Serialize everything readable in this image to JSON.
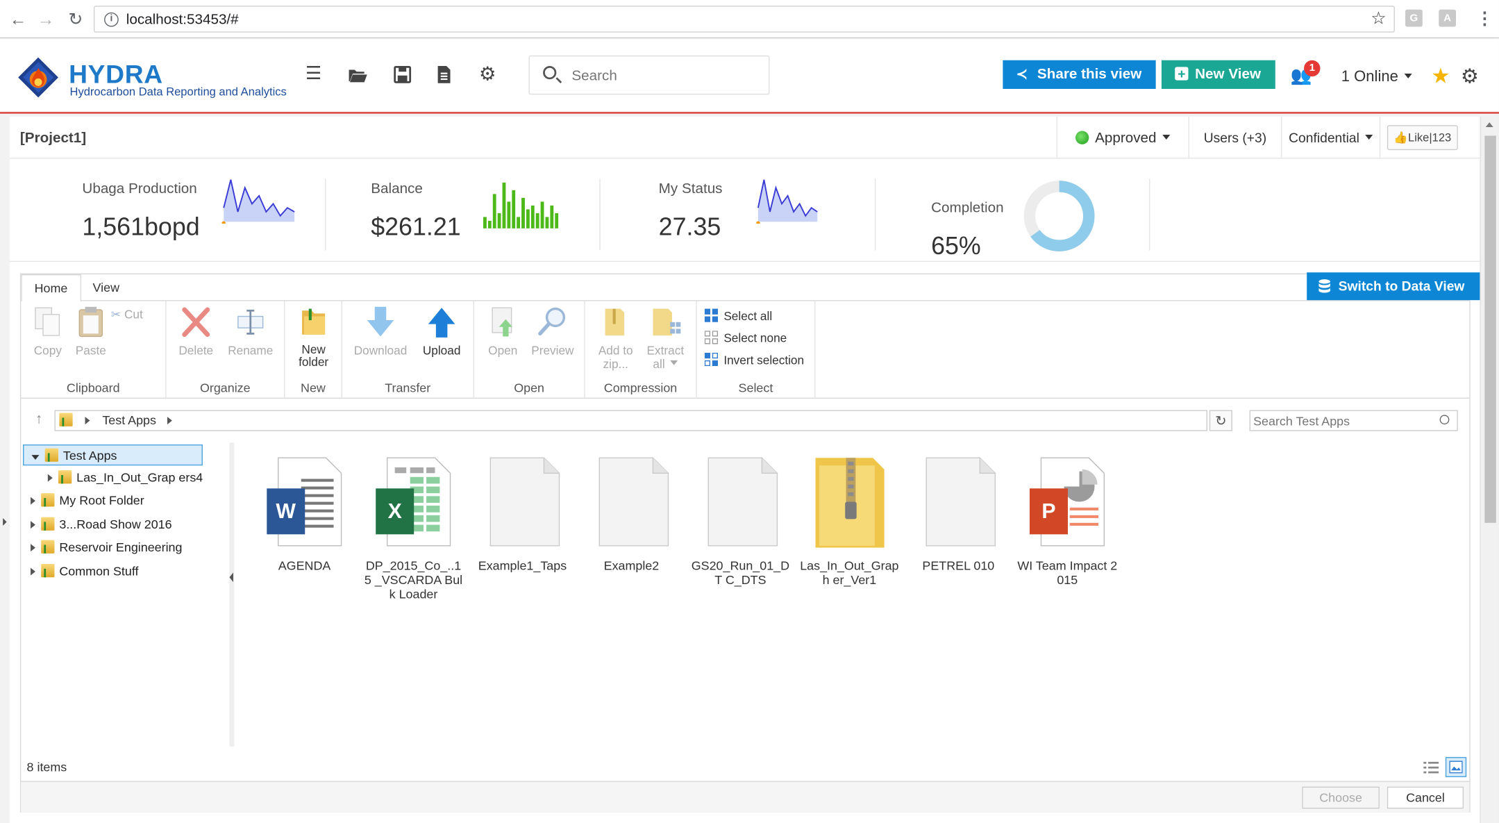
{
  "browser": {
    "url": "localhost:53453/#"
  },
  "header": {
    "brand": "HYDRA",
    "subtitle": "Hydrocarbon Data Reporting and Analytics",
    "search_placeholder": "Search",
    "share_label": "Share this view",
    "new_view_label": "New View",
    "notification_count": "1",
    "online_label": "1 Online",
    "colors": {
      "share": "#0d86d6",
      "new_view": "#1aa793",
      "accent": "#d9534f"
    }
  },
  "project": {
    "title": "[Project1]",
    "status": "Approved",
    "users": "Users (+3)",
    "confidentiality": "Confidential",
    "like": "Like|123"
  },
  "kpis": [
    {
      "label": "Ubaga Production",
      "value": "1,561bopd",
      "spark": [
        3,
        10,
        2,
        8,
        4,
        6,
        2,
        4,
        1,
        3,
        2
      ]
    },
    {
      "label": "Balance",
      "value": "$261.21",
      "bars": [
        3,
        2,
        9,
        4,
        12,
        7,
        10,
        3,
        8,
        5,
        6,
        4,
        7,
        3,
        6,
        4
      ]
    },
    {
      "label": "My Status",
      "value": "27.35",
      "spark": [
        3,
        10,
        2,
        8,
        4,
        6,
        2,
        4,
        1,
        3,
        2
      ]
    },
    {
      "label": "Completion",
      "value": "65%",
      "progress": 0.65
    }
  ],
  "filemanager": {
    "tabs": [
      "Home",
      "View"
    ],
    "switch_label": "Switch to Data View",
    "ribbon": {
      "clipboard": {
        "label": "Clipboard",
        "copy": "Copy",
        "paste": "Paste",
        "cut": "Cut"
      },
      "organize": {
        "label": "Organize",
        "delete": "Delete",
        "rename": "Rename"
      },
      "new": {
        "label": "New",
        "new_folder": "New folder"
      },
      "transfer": {
        "label": "Transfer",
        "download": "Download",
        "upload": "Upload"
      },
      "open": {
        "label": "Open",
        "open": "Open",
        "preview": "Preview"
      },
      "compression": {
        "label": "Compression",
        "add_zip": "Add to zip...",
        "extract": "Extract all"
      },
      "select": {
        "label": "Select",
        "select_all": "Select all",
        "select_none": "Select none",
        "invert": "Invert selection"
      }
    },
    "path": "Test Apps",
    "search_placeholder": "Search Test Apps",
    "tree": [
      {
        "label": "Test Apps",
        "selected": true,
        "open": true,
        "level": 0
      },
      {
        "label": "Las_In_Out_Grap  ers4",
        "level": 1
      },
      {
        "label": "My Root Folder",
        "level": 0
      },
      {
        "label": "3...Road Show 2016",
        "level": 0
      },
      {
        "label": "Reservoir Engineering",
        "level": 0
      },
      {
        "label": "Common Stuff",
        "level": 0
      }
    ],
    "files": [
      {
        "name": "AGENDA",
        "type": "word-icon"
      },
      {
        "name": "DP_2015_Co_..15 _VSCARDA Bulk Loader",
        "type": "excel-icon"
      },
      {
        "name": "Example1_Taps",
        "type": "blank-file-icon"
      },
      {
        "name": "Example2",
        "type": "blank-file-icon"
      },
      {
        "name": "GS20_Run_01_DT C_DTS",
        "type": "blank-file-icon"
      },
      {
        "name": "Las_In_Out_Graph er_Ver1",
        "type": "zip-folder-icon"
      },
      {
        "name": "PETREL 010",
        "type": "blank-file-icon"
      },
      {
        "name": "WI Team Impact 2015",
        "type": "powerpoint-icon"
      }
    ],
    "status": "8 items",
    "choose_label": "Choose",
    "cancel_label": "Cancel"
  }
}
